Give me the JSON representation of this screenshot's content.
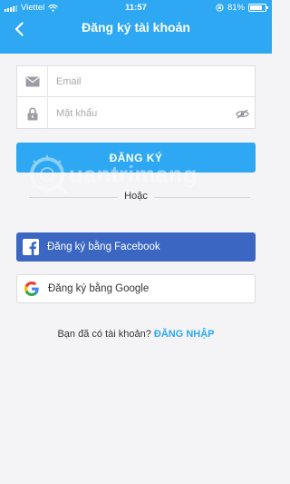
{
  "status_bar": {
    "carrier": "Viettel",
    "time": "11:57",
    "battery_pct": "81%",
    "battery_level": 0.81
  },
  "header": {
    "title": "Đăng ký tài khoản",
    "back_icon": "chevron-left-icon",
    "background_color": "#2ea8f2"
  },
  "form": {
    "email": {
      "placeholder": "Email",
      "value": "",
      "icon": "envelope-icon"
    },
    "password": {
      "placeholder": "Mật khẩu",
      "value": "",
      "icon": "lock-icon",
      "toggle_icon": "eye-off-icon"
    }
  },
  "register_button": {
    "label": "ĐĂNG KÝ"
  },
  "divider": {
    "text": "Hoặc"
  },
  "social": {
    "facebook": {
      "label": "Đăng ký bằng Facebook",
      "icon": "facebook-icon",
      "color": "#3b67c2"
    },
    "google": {
      "label": "Đăng ký bằng Google",
      "icon": "google-icon"
    }
  },
  "login_prompt": {
    "text": "Bạn đã có tài khoản?",
    "link": "ĐĂNG NHẬP"
  },
  "watermark": {
    "text": "uantrimang"
  }
}
